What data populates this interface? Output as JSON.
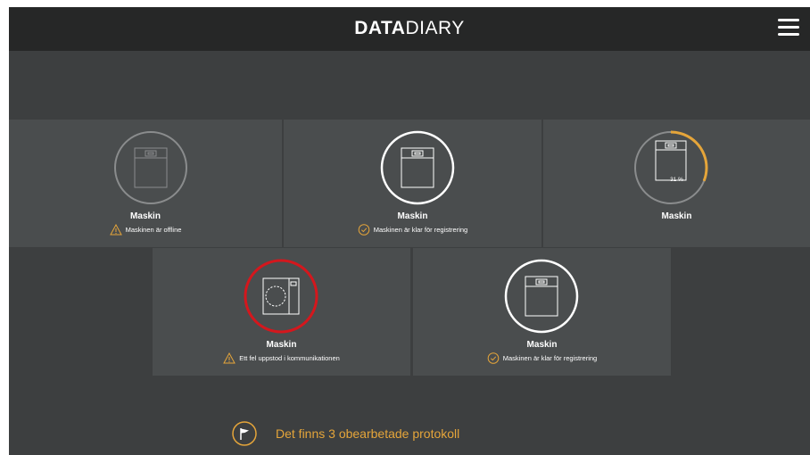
{
  "header": {
    "logo_bold": "DATA",
    "logo_thin": "DIARY",
    "menu_icon": "hamburger-menu-icon"
  },
  "machines": [
    {
      "name": "Maskin",
      "status": "Maskinen är offline",
      "state": "offline",
      "status_icon": "warning-icon"
    },
    {
      "name": "Maskin",
      "status": "Maskinen är klar för registrering",
      "state": "ready",
      "status_icon": "check-circle-icon"
    },
    {
      "name": "Maskin",
      "status": "",
      "state": "progress",
      "progress_label": "31 %",
      "progress": 0.31
    },
    {
      "name": "Maskin",
      "status": "Ett fel uppstod i kommunikationen",
      "state": "error",
      "status_icon": "warning-icon"
    },
    {
      "name": "Maskin",
      "status": "Maskinen är klar för registrering",
      "state": "ready",
      "status_icon": "check-circle-icon"
    }
  ],
  "footer": {
    "message": "Det finns 3 obearbetade protokoll",
    "icon": "flag-icon"
  },
  "colors": {
    "accent": "#e5a53a",
    "error": "#d4171d",
    "offline": "#8a8c8d",
    "ready": "#ffffff",
    "card": "#4a4d4e",
    "background": "#3d3f40",
    "topbar": "#262727"
  }
}
